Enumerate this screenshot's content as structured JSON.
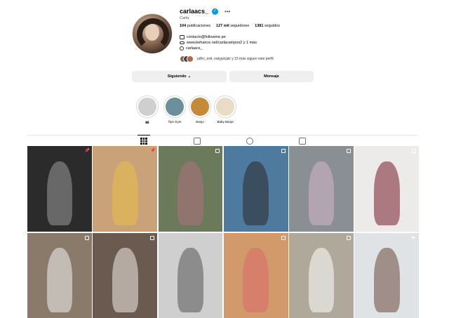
{
  "profile": {
    "username": "carlaacs_",
    "full_name": "Carla",
    "stats": {
      "posts": "104",
      "posts_label": "publicaciones",
      "followers": "127 mil",
      "followers_label": "seguidores",
      "following": "1381",
      "following_label": "seguidos"
    },
    "contact": "contacto@followme.pe",
    "link": "www.behance.net/carlacampos2 y 1 más",
    "threads_handle": "carlaacs_",
    "followed_by": "pdhc_exit, natyjulcatv y 15 más siguen este perfil"
  },
  "buttons": {
    "following": "Siguiendo",
    "message": "Mensaje"
  },
  "highlights": [
    {
      "label": "📷",
      "color": "#cfcfcf"
    },
    {
      "label": "Tips Gym",
      "color": "#6b8f9c"
    },
    {
      "label": "Banjo",
      "color": "#c48a3a"
    },
    {
      "label": "Baby Banjo",
      "color": "#e9dcc4"
    }
  ],
  "tabs": [
    "posts",
    "reels",
    "reposts",
    "tagged"
  ],
  "posts": [
    {
      "bg": "#2b2b2b",
      "fig": "#9a9a9a",
      "badge": "pin"
    },
    {
      "bg": "#c9a27a",
      "fig": "#e8c048",
      "badge": "pin"
    },
    {
      "bg": "#6a7a5a",
      "fig": "#b07080",
      "badge": "multi"
    },
    {
      "bg": "#4f7aa0",
      "fig": "#2a2a2a",
      "badge": "multi"
    },
    {
      "bg": "#8a8f94",
      "fig": "#d6b7c8",
      "badge": "multi"
    },
    {
      "bg": "#ecebea",
      "fig": "#7a1c2a",
      "badge": "multi"
    },
    {
      "bg": "#8a7a6a",
      "fig": "#f2f2f2",
      "badge": "multi"
    },
    {
      "bg": "#6a5a50",
      "fig": "#f0ece6",
      "badge": "multi"
    },
    {
      "bg": "#cfcfcf",
      "fig": "#555555",
      "badge": "none"
    },
    {
      "bg": "#d29a6a",
      "fig": "#d86a6a",
      "badge": "multi"
    },
    {
      "bg": "#b0a89a",
      "fig": "#ffffff",
      "badge": "multi"
    },
    {
      "bg": "#dfe3e6",
      "fig": "#6a4a3a",
      "badge": "reel"
    }
  ]
}
